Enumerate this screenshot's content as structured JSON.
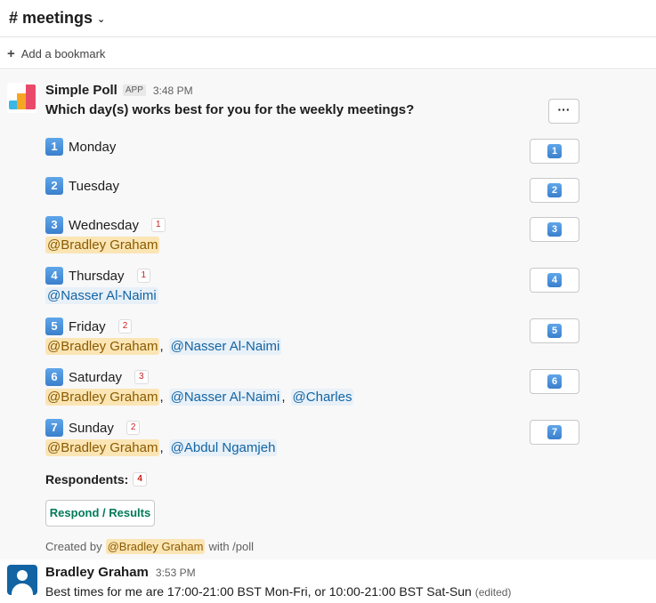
{
  "header": {
    "channel": "# meetings"
  },
  "bookmark_bar": {
    "label": "Add a bookmark"
  },
  "poll_message": {
    "sender": "Simple Poll",
    "app_badge": "APP",
    "time": "3:48 PM",
    "question": "Which day(s) works best for you for the weekly meetings?",
    "more_label": "···",
    "options": [
      {
        "num": "1",
        "day": "Monday",
        "count": "",
        "voters": []
      },
      {
        "num": "2",
        "day": "Tuesday",
        "count": "",
        "voters": []
      },
      {
        "num": "3",
        "day": "Wednesday",
        "count": "1",
        "voters": [
          "@Bradley Graham"
        ]
      },
      {
        "num": "4",
        "day": "Thursday",
        "count": "1",
        "voters": [
          "@Nasser Al-Naimi"
        ]
      },
      {
        "num": "5",
        "day": "Friday",
        "count": "2",
        "voters": [
          "@Bradley Graham",
          "@Nasser Al-Naimi"
        ]
      },
      {
        "num": "6",
        "day": "Saturday",
        "count": "3",
        "voters": [
          "@Bradley Graham",
          "@Nasser Al-Naimi",
          "@Charles"
        ]
      },
      {
        "num": "7",
        "day": "Sunday",
        "count": "2",
        "voters": [
          "@Bradley Graham",
          "@Abdul Ngamjeh"
        ]
      }
    ],
    "respondents_label": "Respondents:",
    "respondents_count": "4",
    "respond_button": "Respond / Results",
    "created_prefix": "Created by",
    "created_by": "@Bradley Graham",
    "created_suffix": "with /poll"
  },
  "user_message": {
    "sender": "Bradley Graham",
    "time": "3:53 PM",
    "text": "Best times for me are 17:00-21:00 BST Mon-Fri, or 10:00-21:00 BST Sat-Sun",
    "edited": "(edited)"
  },
  "colors": {
    "mention_self_bg": "#fbe5b4",
    "mention_bg": "#e8f0f8",
    "respond_green": "#007a5a",
    "count_red": "#cc2222"
  }
}
